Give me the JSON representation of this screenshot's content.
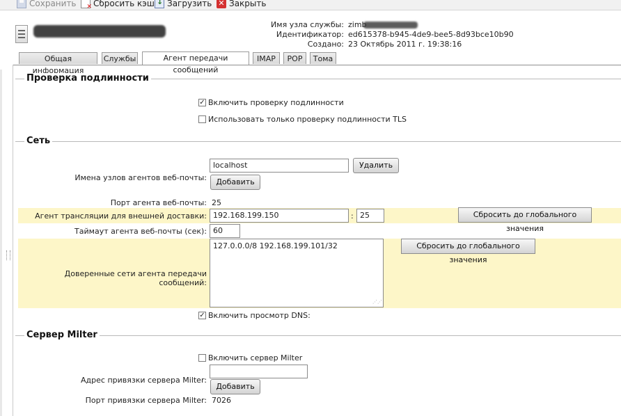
{
  "toolbar": {
    "save_label": "Сохранить",
    "flush_label": "Сбросить кэш",
    "load_label": "Загрузить",
    "close_label": "Закрыть",
    "close_glyph": "✕"
  },
  "header": {
    "host_label": "Имя узла службы:",
    "host_value_prefix": "zimb",
    "id_label": "Идентификатор:",
    "id_value": "ed615378-b945-4de9-bee5-8d93bce10b90",
    "created_label": "Создано:",
    "created_value": "23 Октябрь 2011 г. 19:38:16"
  },
  "tabs": [
    {
      "label": "Общая информация"
    },
    {
      "label": "Службы"
    },
    {
      "label": "Агент передачи сообщений"
    },
    {
      "label": "IMAP"
    },
    {
      "label": "POP"
    },
    {
      "label": "Тома"
    }
  ],
  "sections": {
    "auth_title": "Проверка подлинности",
    "network_title": "Сеть",
    "milter_title": "Сервер Milter"
  },
  "auth": {
    "enable_label": "Включить проверку подлинности",
    "enable_checked": true,
    "tls_only_label": "Использовать только проверку подлинности TLS",
    "tls_only_checked": false
  },
  "network": {
    "webmail_hosts_label": "Имена узлов агентов веб-почты:",
    "webmail_host_value": "localhost",
    "remove_button": "Удалить",
    "add_button": "Добавить",
    "webmail_port_label": "Порт агента веб-почты:",
    "webmail_port_value": "25",
    "relay_label": "Агент трансляции для внешней доставки:",
    "relay_host": "192.168.199.150",
    "relay_separator": ":",
    "relay_port": "25",
    "reset_button": "Сбросить до глобального значения",
    "timeout_label": "Таймаут агента веб-почты (сек):",
    "timeout_value": "60",
    "trusted_label": "Доверенные сети агента передачи сообщений:",
    "trusted_value": "127.0.0.0/8 192.168.199.101/32",
    "trusted_reset_button": "Сбросить до глобального значения",
    "dns_label": "Включить просмотр DNS:",
    "dns_checked": true
  },
  "milter": {
    "enable_label": "Включить сервер Milter",
    "enable_checked": false,
    "bind_addr_label": "Адрес привязки сервера Milter:",
    "bind_addr_value": "",
    "add_button": "Добавить",
    "bind_port_label": "Порт привязки сервера Milter:",
    "bind_port_value": "7026"
  },
  "colors": {
    "highlight_row": "#fdf6c8",
    "close_icon": "#d43131"
  }
}
